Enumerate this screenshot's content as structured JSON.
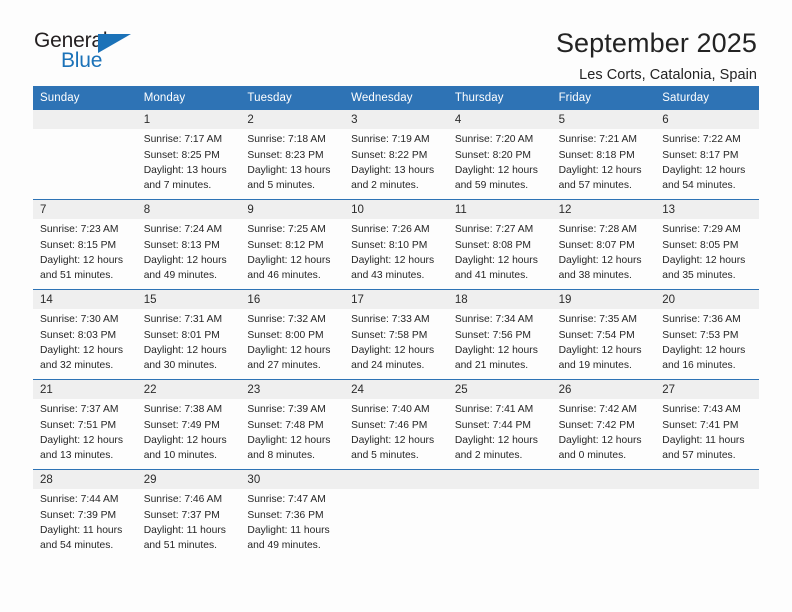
{
  "brand": {
    "name_part1": "General",
    "name_part2": "Blue",
    "triangle_color": "#1b72b8",
    "text_color": "#231f20"
  },
  "header": {
    "title": "September 2025",
    "location": "Les Corts, Catalonia, Spain"
  },
  "theme": {
    "header_blue": "#2e73b5",
    "daynum_gray": "#efefef",
    "page_bg": "#fdfdfd",
    "text": "#262626"
  },
  "calendar": {
    "weekdays": [
      "Sunday",
      "Monday",
      "Tuesday",
      "Wednesday",
      "Thursday",
      "Friday",
      "Saturday"
    ],
    "weeks": [
      [
        {
          "day": "",
          "sunrise": "",
          "sunset": "",
          "daylight1": "",
          "daylight2": ""
        },
        {
          "day": "1",
          "sunrise": "Sunrise: 7:17 AM",
          "sunset": "Sunset: 8:25 PM",
          "daylight1": "Daylight: 13 hours",
          "daylight2": "and 7 minutes."
        },
        {
          "day": "2",
          "sunrise": "Sunrise: 7:18 AM",
          "sunset": "Sunset: 8:23 PM",
          "daylight1": "Daylight: 13 hours",
          "daylight2": "and 5 minutes."
        },
        {
          "day": "3",
          "sunrise": "Sunrise: 7:19 AM",
          "sunset": "Sunset: 8:22 PM",
          "daylight1": "Daylight: 13 hours",
          "daylight2": "and 2 minutes."
        },
        {
          "day": "4",
          "sunrise": "Sunrise: 7:20 AM",
          "sunset": "Sunset: 8:20 PM",
          "daylight1": "Daylight: 12 hours",
          "daylight2": "and 59 minutes."
        },
        {
          "day": "5",
          "sunrise": "Sunrise: 7:21 AM",
          "sunset": "Sunset: 8:18 PM",
          "daylight1": "Daylight: 12 hours",
          "daylight2": "and 57 minutes."
        },
        {
          "day": "6",
          "sunrise": "Sunrise: 7:22 AM",
          "sunset": "Sunset: 8:17 PM",
          "daylight1": "Daylight: 12 hours",
          "daylight2": "and 54 minutes."
        }
      ],
      [
        {
          "day": "7",
          "sunrise": "Sunrise: 7:23 AM",
          "sunset": "Sunset: 8:15 PM",
          "daylight1": "Daylight: 12 hours",
          "daylight2": "and 51 minutes."
        },
        {
          "day": "8",
          "sunrise": "Sunrise: 7:24 AM",
          "sunset": "Sunset: 8:13 PM",
          "daylight1": "Daylight: 12 hours",
          "daylight2": "and 49 minutes."
        },
        {
          "day": "9",
          "sunrise": "Sunrise: 7:25 AM",
          "sunset": "Sunset: 8:12 PM",
          "daylight1": "Daylight: 12 hours",
          "daylight2": "and 46 minutes."
        },
        {
          "day": "10",
          "sunrise": "Sunrise: 7:26 AM",
          "sunset": "Sunset: 8:10 PM",
          "daylight1": "Daylight: 12 hours",
          "daylight2": "and 43 minutes."
        },
        {
          "day": "11",
          "sunrise": "Sunrise: 7:27 AM",
          "sunset": "Sunset: 8:08 PM",
          "daylight1": "Daylight: 12 hours",
          "daylight2": "and 41 minutes."
        },
        {
          "day": "12",
          "sunrise": "Sunrise: 7:28 AM",
          "sunset": "Sunset: 8:07 PM",
          "daylight1": "Daylight: 12 hours",
          "daylight2": "and 38 minutes."
        },
        {
          "day": "13",
          "sunrise": "Sunrise: 7:29 AM",
          "sunset": "Sunset: 8:05 PM",
          "daylight1": "Daylight: 12 hours",
          "daylight2": "and 35 minutes."
        }
      ],
      [
        {
          "day": "14",
          "sunrise": "Sunrise: 7:30 AM",
          "sunset": "Sunset: 8:03 PM",
          "daylight1": "Daylight: 12 hours",
          "daylight2": "and 32 minutes."
        },
        {
          "day": "15",
          "sunrise": "Sunrise: 7:31 AM",
          "sunset": "Sunset: 8:01 PM",
          "daylight1": "Daylight: 12 hours",
          "daylight2": "and 30 minutes."
        },
        {
          "day": "16",
          "sunrise": "Sunrise: 7:32 AM",
          "sunset": "Sunset: 8:00 PM",
          "daylight1": "Daylight: 12 hours",
          "daylight2": "and 27 minutes."
        },
        {
          "day": "17",
          "sunrise": "Sunrise: 7:33 AM",
          "sunset": "Sunset: 7:58 PM",
          "daylight1": "Daylight: 12 hours",
          "daylight2": "and 24 minutes."
        },
        {
          "day": "18",
          "sunrise": "Sunrise: 7:34 AM",
          "sunset": "Sunset: 7:56 PM",
          "daylight1": "Daylight: 12 hours",
          "daylight2": "and 21 minutes."
        },
        {
          "day": "19",
          "sunrise": "Sunrise: 7:35 AM",
          "sunset": "Sunset: 7:54 PM",
          "daylight1": "Daylight: 12 hours",
          "daylight2": "and 19 minutes."
        },
        {
          "day": "20",
          "sunrise": "Sunrise: 7:36 AM",
          "sunset": "Sunset: 7:53 PM",
          "daylight1": "Daylight: 12 hours",
          "daylight2": "and 16 minutes."
        }
      ],
      [
        {
          "day": "21",
          "sunrise": "Sunrise: 7:37 AM",
          "sunset": "Sunset: 7:51 PM",
          "daylight1": "Daylight: 12 hours",
          "daylight2": "and 13 minutes."
        },
        {
          "day": "22",
          "sunrise": "Sunrise: 7:38 AM",
          "sunset": "Sunset: 7:49 PM",
          "daylight1": "Daylight: 12 hours",
          "daylight2": "and 10 minutes."
        },
        {
          "day": "23",
          "sunrise": "Sunrise: 7:39 AM",
          "sunset": "Sunset: 7:48 PM",
          "daylight1": "Daylight: 12 hours",
          "daylight2": "and 8 minutes."
        },
        {
          "day": "24",
          "sunrise": "Sunrise: 7:40 AM",
          "sunset": "Sunset: 7:46 PM",
          "daylight1": "Daylight: 12 hours",
          "daylight2": "and 5 minutes."
        },
        {
          "day": "25",
          "sunrise": "Sunrise: 7:41 AM",
          "sunset": "Sunset: 7:44 PM",
          "daylight1": "Daylight: 12 hours",
          "daylight2": "and 2 minutes."
        },
        {
          "day": "26",
          "sunrise": "Sunrise: 7:42 AM",
          "sunset": "Sunset: 7:42 PM",
          "daylight1": "Daylight: 12 hours",
          "daylight2": "and 0 minutes."
        },
        {
          "day": "27",
          "sunrise": "Sunrise: 7:43 AM",
          "sunset": "Sunset: 7:41 PM",
          "daylight1": "Daylight: 11 hours",
          "daylight2": "and 57 minutes."
        }
      ],
      [
        {
          "day": "28",
          "sunrise": "Sunrise: 7:44 AM",
          "sunset": "Sunset: 7:39 PM",
          "daylight1": "Daylight: 11 hours",
          "daylight2": "and 54 minutes."
        },
        {
          "day": "29",
          "sunrise": "Sunrise: 7:46 AM",
          "sunset": "Sunset: 7:37 PM",
          "daylight1": "Daylight: 11 hours",
          "daylight2": "and 51 minutes."
        },
        {
          "day": "30",
          "sunrise": "Sunrise: 7:47 AM",
          "sunset": "Sunset: 7:36 PM",
          "daylight1": "Daylight: 11 hours",
          "daylight2": "and 49 minutes."
        },
        {
          "day": "",
          "sunrise": "",
          "sunset": "",
          "daylight1": "",
          "daylight2": ""
        },
        {
          "day": "",
          "sunrise": "",
          "sunset": "",
          "daylight1": "",
          "daylight2": ""
        },
        {
          "day": "",
          "sunrise": "",
          "sunset": "",
          "daylight1": "",
          "daylight2": ""
        },
        {
          "day": "",
          "sunrise": "",
          "sunset": "",
          "daylight1": "",
          "daylight2": ""
        }
      ]
    ]
  }
}
